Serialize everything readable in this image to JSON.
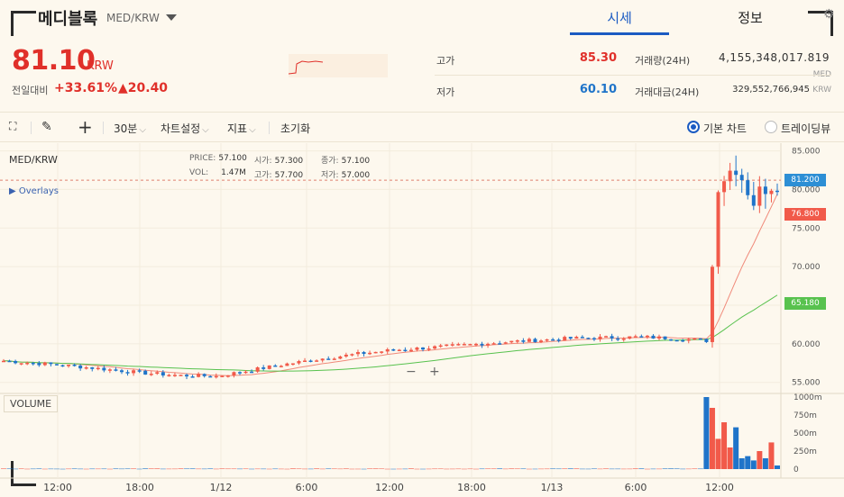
{
  "header": {
    "coin_name": "메디블록",
    "coin_pair": "MED/KRW",
    "tabs": [
      {
        "label": "시세",
        "active": true
      },
      {
        "label": "정보",
        "active": false
      }
    ]
  },
  "ticker": {
    "price": "81.10",
    "unit": "KRW",
    "change_label": "전일대비",
    "change_rate": "+33.61%",
    "change_price": "▲20.40",
    "high_label": "고가",
    "high_value": "85.30",
    "low_label": "저가",
    "low_value": "60.10",
    "volume_label": "거래량(24H)",
    "volume_value": "4,155,348,017.819",
    "volume_unit": "MED",
    "amount_label": "거래대금(24H)",
    "amount_value": "329,552,766,945",
    "amount_unit": "KRW"
  },
  "toolbar": {
    "interval": "30분",
    "chart_settings": "차트설정",
    "indicators": "지표",
    "reset": "초기화",
    "basic_chart": "기본 차트",
    "tradingview": "트레이딩뷰"
  },
  "chart": {
    "pair": "MED/KRW",
    "overlays": "Overlays",
    "legend": {
      "price_label": "PRICE:",
      "price_value": "57.100",
      "open_label": "시가:",
      "open_value": "57.300",
      "close_label": "종가:",
      "close_value": "57.100",
      "vol_label": "VOL:",
      "vol_value": "1.47M",
      "high_label": "고가:",
      "high_value": "57.700",
      "low_label": "저가:",
      "low_value": "57.000"
    },
    "volume_label": "VOLUME",
    "zoom_out": "−",
    "zoom_in": "+",
    "colors": {
      "up": "#f15a4a",
      "down": "#1f74c9",
      "ma_short": "#f08a7a",
      "ma_long": "#58c24e",
      "current": "#2d8fd5"
    }
  },
  "chart_data": {
    "type": "candlestick",
    "x_ticks": [
      "12:00",
      "18:00",
      "1/12",
      "6:00",
      "12:00",
      "18:00",
      "1/13",
      "6:00",
      "12:00"
    ],
    "y_ticks": [
      "85.000",
      "80.000",
      "75.000",
      "70.000",
      "65.000",
      "60.000",
      "55.000"
    ],
    "ylim": [
      53.8,
      86
    ],
    "volume_ticks": [
      "1000m",
      "750m",
      "500m",
      "250m",
      "0"
    ],
    "price_tags": [
      {
        "label": "81.200",
        "value": 81.2,
        "color": "#2d8fd5"
      },
      {
        "label": "76.800",
        "value": 76.8,
        "color": "#f15a4a"
      },
      {
        "label": "65.180",
        "value": 65.18,
        "color": "#58c24e"
      }
    ],
    "anchors": [
      [
        0,
        57.8
      ],
      [
        12,
        57.1
      ],
      [
        24,
        56.2
      ],
      [
        30,
        55.9
      ],
      [
        36,
        55.8
      ],
      [
        42,
        56.6
      ],
      [
        48,
        57.4
      ],
      [
        54,
        58.1
      ],
      [
        60,
        58.7
      ],
      [
        66,
        59.2
      ],
      [
        72,
        59.5
      ],
      [
        84,
        60.2
      ],
      [
        96,
        60.7
      ],
      [
        108,
        60.9
      ],
      [
        116,
        60.6
      ],
      [
        119,
        60.4
      ],
      [
        120,
        70
      ],
      [
        121,
        81
      ],
      [
        124,
        83.2
      ],
      [
        127,
        78.5
      ],
      [
        129,
        80.5
      ],
      [
        131,
        81.2
      ]
    ],
    "volume_spikes": [
      [
        119,
        1000
      ],
      [
        120,
        850
      ],
      [
        121,
        420
      ],
      [
        122,
        650
      ],
      [
        123,
        300
      ],
      [
        124,
        580
      ],
      [
        125,
        150
      ],
      [
        126,
        180
      ],
      [
        127,
        120
      ],
      [
        128,
        250
      ],
      [
        129,
        150
      ],
      [
        130,
        370
      ],
      [
        131,
        50
      ]
    ]
  }
}
